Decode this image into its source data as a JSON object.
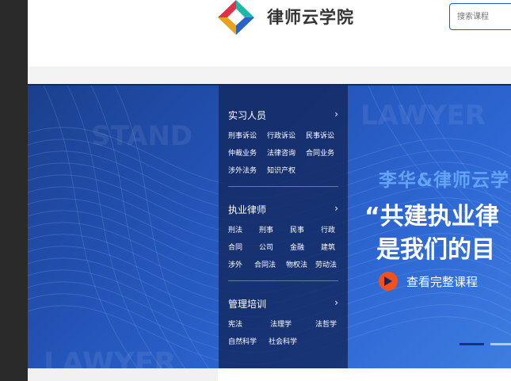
{
  "header": {
    "brand_name": "律师云学院",
    "search_placeholder": "搜索课程"
  },
  "menu": {
    "sections": [
      {
        "title": "实习人员",
        "rows": [
          [
            "刑事诉讼",
            "行政诉讼",
            "民事诉讼"
          ],
          [
            "仲裁业务",
            "法律咨询",
            "合同业务"
          ],
          [
            "涉外法务",
            "知识产权"
          ]
        ]
      },
      {
        "title": "执业律师",
        "rows": [
          [
            "刑法",
            "刑事",
            "民事",
            "行政"
          ],
          [
            "合同",
            "公司",
            "金融",
            "建筑"
          ],
          [
            "涉外",
            "合同法",
            "物权法",
            "劳动法"
          ]
        ]
      },
      {
        "title": "管理培训",
        "rows": [
          [
            "宪法",
            "法理学",
            "法哲学"
          ],
          [
            "自然科学",
            "社会科学"
          ]
        ]
      }
    ]
  },
  "banner": {
    "watermark_1": "LAWYER",
    "watermark_2": "STAND",
    "slogan_top": "李华&律师云学",
    "slogan_line1": "“共建执业律",
    "slogan_line2": "是我们的目",
    "cta_label": "查看完整课程"
  },
  "colors": {
    "brand_blue": "#1e57c4",
    "cta_orange": "#f0521f"
  }
}
